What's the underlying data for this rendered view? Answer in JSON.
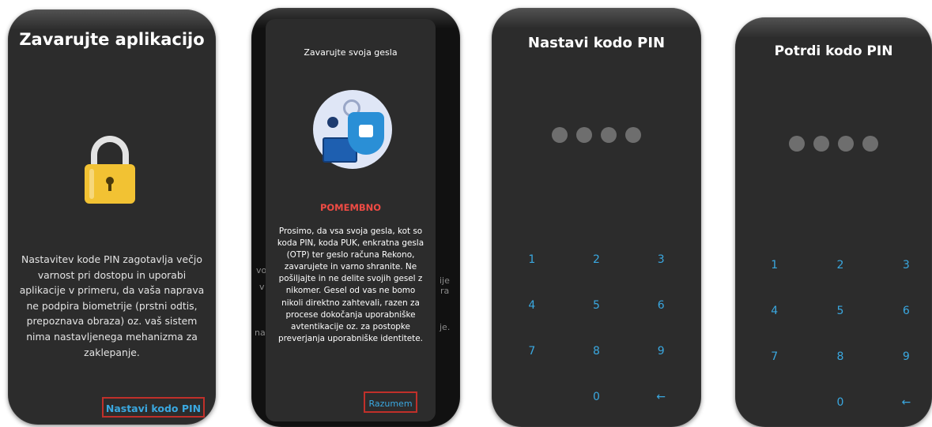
{
  "screen1": {
    "title": "Zavarujte aplikacijo",
    "description": "Nastavitev kode PIN zagotavlja večjo varnost pri dostopu in uporabi aplikacije v primeru, da vaša naprava ne podpira biometrije (prstni odtis, prepoznava obraza) oz. vaš sistem nima nastavljenega mehanizma za zaklepanje.",
    "set_pin_button": "Nastavi kodo PIN",
    "lock_icon": "padlock-icon"
  },
  "screen2": {
    "dialog_title": "Zavarujte svoja gesla",
    "illustration": "security-shield-illustration",
    "warning": "POMEMBNO",
    "body": "Prosimo, da vsa svoja gesla, kot so koda PIN, koda PUK, enkratna gesla (OTP) ter geslo računa Rekono, zavarujete in varno shranite. Ne pošiljajte in ne delite svojih gesel z nikomer. Gesel od vas ne bomo nikoli direktno zahtevali, razen za procese dokočanja uporabniške avtentikacije oz. za postopke preverjanja uporabniške identitete.",
    "confirm_button": "Razumem",
    "background_fragments": [
      "vo",
      "v",
      "na",
      "ije",
      "ra",
      "je."
    ]
  },
  "screen3": {
    "title": "Nastavi kodo PIN",
    "pin_dots": 4,
    "keys": [
      "1",
      "2",
      "3",
      "4",
      "5",
      "6",
      "7",
      "8",
      "9",
      "",
      "0",
      "←"
    ]
  },
  "screen4": {
    "title": "Potrdi kodo PIN",
    "pin_dots": 4,
    "keys": [
      "1",
      "2",
      "3",
      "4",
      "5",
      "6",
      "7",
      "8",
      "9",
      "",
      "0",
      "←"
    ]
  },
  "colors": {
    "background": "#2c2c2c",
    "accent": "#3aa8e0",
    "highlight_border": "#c0302a",
    "warning": "#f04b44",
    "lock": "#f2c233",
    "dot": "#6e6e6e"
  }
}
